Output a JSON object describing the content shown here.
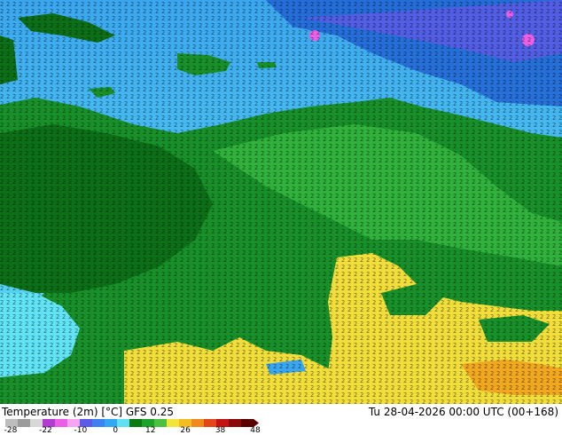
{
  "map": {
    "description_layers": [
      "sea",
      "land",
      "numeric-temperature-grid"
    ],
    "colors": {
      "sea_cold": "#1e5ad2",
      "sea_mid": "#3aa6ef",
      "sea_cyan": "#5fe3f5",
      "land_dark": "#0a6f16",
      "land_mid": "#17902a",
      "land_light": "#2fb13b",
      "warm_yellow": "#f2de3a",
      "warm_orange": "#f2a81e",
      "cold_pink": "#ea5fe6",
      "cold_violet": "#8a4cf0"
    }
  },
  "footer": {
    "title": "Temperature (2m) [°C] GFS 0.25",
    "valid_time": "Tu 28-04-2026 00:00 UTC (00+168)"
  },
  "legend": {
    "ticks": [
      "-28",
      "-22",
      "-10",
      "0",
      "12",
      "26",
      "38",
      "48"
    ],
    "colors": [
      "#bdbdbd",
      "#9b9b9b",
      "#d8d8d8",
      "#b23bd0",
      "#ea5fe6",
      "#f7a4f3",
      "#5b5be8",
      "#3b82f0",
      "#33a7f0",
      "#60e0f2",
      "#0a7a12",
      "#1ea32a",
      "#4cc040",
      "#f2e43a",
      "#f2bd21",
      "#f08a1a",
      "#e2461a",
      "#c21212",
      "#8a0a0a",
      "#5a0000"
    ]
  }
}
